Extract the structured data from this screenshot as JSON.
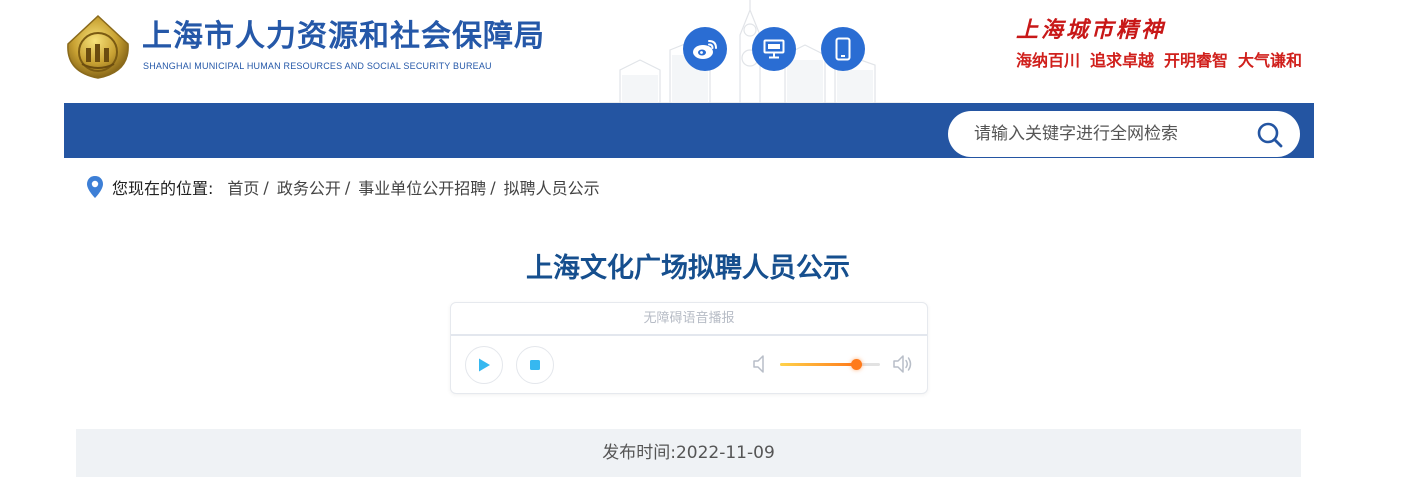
{
  "header": {
    "site_title": "上海市人力资源和社会保障局",
    "site_subtitle": "SHANGHAI MUNICIPAL HUMAN RESOURCES AND SOCIAL SECURITY BUREAU",
    "social_buttons": [
      "weibo-icon",
      "desktop-icon",
      "mobile-icon"
    ],
    "spirit_title": "上海城市精神",
    "spirit_words": [
      "海纳百川",
      "追求卓越",
      "开明睿智",
      "大气谦和"
    ]
  },
  "search": {
    "placeholder": "请输入关键字进行全网检索"
  },
  "breadcrumb": {
    "label": "您现在的位置:",
    "items": [
      "首页",
      "政务公开",
      "事业单位公开招聘",
      "拟聘人员公示"
    ],
    "separator": "/"
  },
  "article": {
    "title": "上海文化广场拟聘人员公示"
  },
  "player": {
    "label": "无障碍语音播报",
    "volume_percent": 76
  },
  "date": {
    "text": "发布时间:2022-11-09"
  },
  "colors": {
    "brand_blue": "#2455a2",
    "title_blue": "#164f8e",
    "spirit_red": "#c81818",
    "button_blue": "#2a6dd3"
  }
}
